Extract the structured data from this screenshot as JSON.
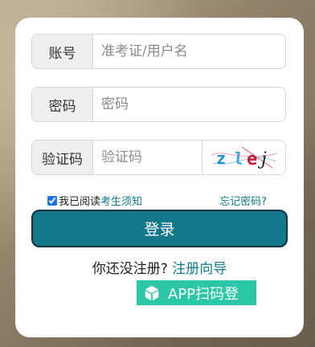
{
  "form": {
    "account": {
      "label": "账号",
      "placeholder": "准考证/用户名",
      "value": ""
    },
    "password": {
      "label": "密码",
      "placeholder": "密码",
      "value": ""
    },
    "captcha": {
      "label": "验证码",
      "placeholder": "验证码",
      "value": "",
      "image_text": "zlej"
    }
  },
  "agreement": {
    "checked": true,
    "prefix": "我已阅读",
    "link": "考生须知"
  },
  "forgot_password": "忘记密码?",
  "login_button": "登录",
  "register": {
    "question": "你还没注册?",
    "link": "注册向导"
  },
  "app_login": {
    "label": "APP扫码登",
    "icon": "cube-icon"
  },
  "colors": {
    "accent": "#13788a",
    "app_button": "#2bc7a6"
  }
}
